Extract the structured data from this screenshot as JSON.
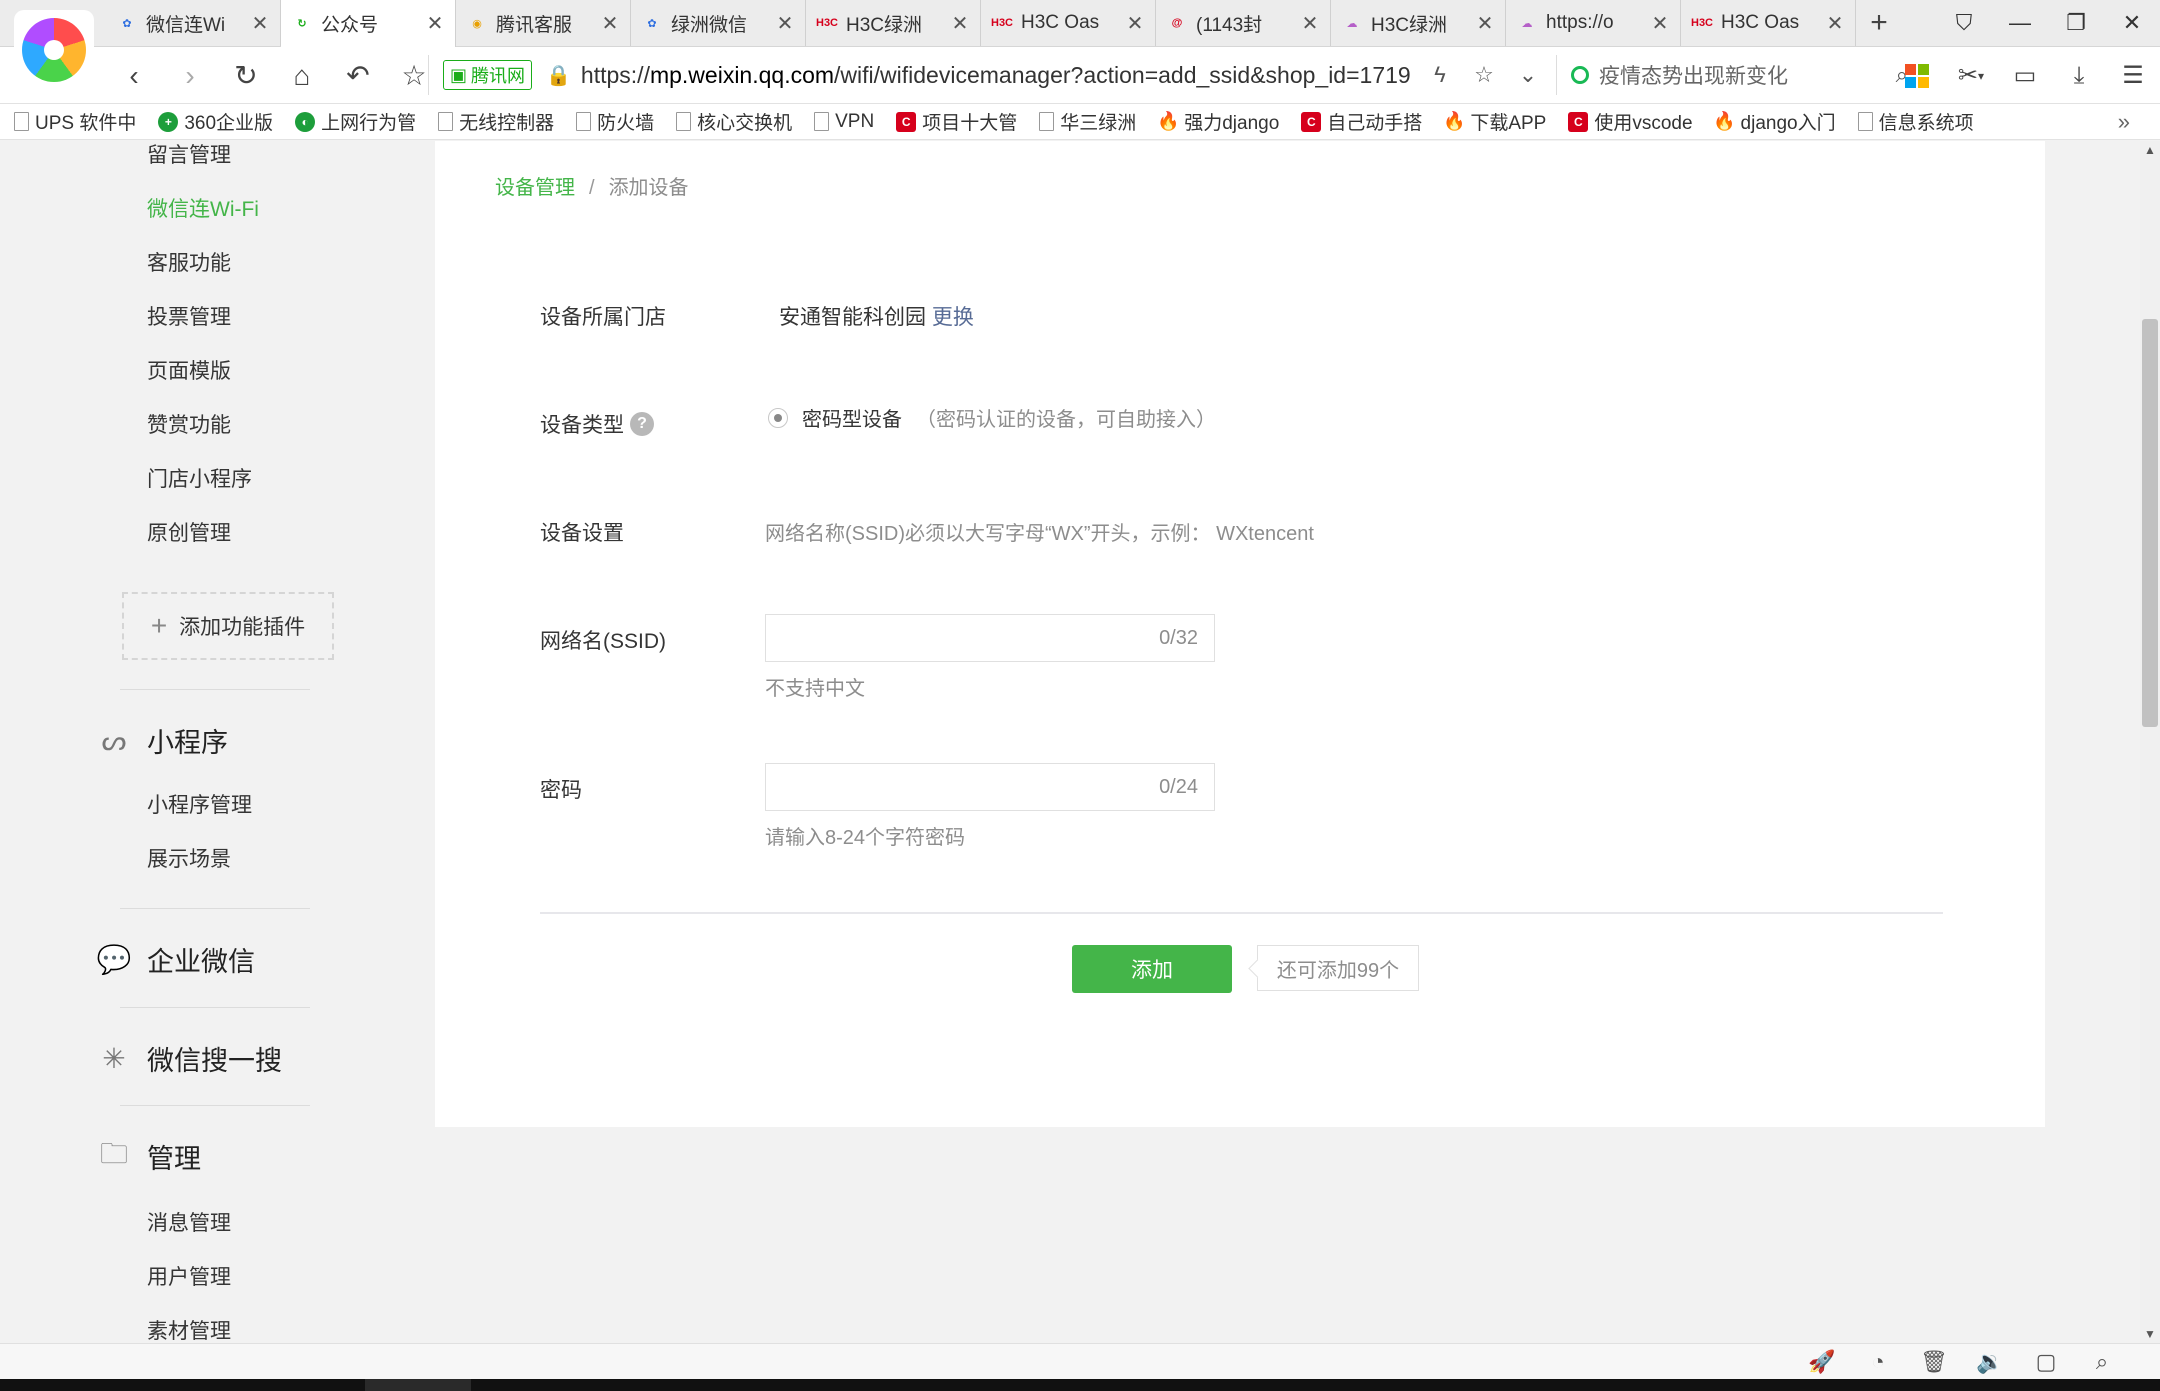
{
  "tabs": [
    {
      "title": "微信连Wi",
      "icon": "paw-icon",
      "color": "#2f6fe0",
      "glyph": "✿",
      "active": false
    },
    {
      "title": "公众号",
      "icon": "wechat-refresh-icon",
      "color": "#1aad19",
      "glyph": "↻",
      "active": true
    },
    {
      "title": "腾讯客服",
      "icon": "browser-icon",
      "color": "#e8a000",
      "glyph": "◉",
      "active": false
    },
    {
      "title": "绿洲微信",
      "icon": "paw-icon",
      "color": "#2f6fe0",
      "glyph": "✿",
      "active": false
    },
    {
      "title": "H3C绿洲",
      "icon": "h3c-icon",
      "color": "#d6001c",
      "glyph": "H3C",
      "active": false
    },
    {
      "title": "H3C Oas",
      "icon": "h3c-icon",
      "color": "#d6001c",
      "glyph": "H3C",
      "active": false
    },
    {
      "title": "(1143封",
      "icon": "mail-icon",
      "color": "#d6001c",
      "glyph": "@",
      "active": false
    },
    {
      "title": "H3C绿洲",
      "icon": "cloud-icon",
      "color": "#b55fc8",
      "glyph": "☁",
      "active": false
    },
    {
      "title": "https://o",
      "icon": "cloud-icon",
      "color": "#b55fc8",
      "glyph": "☁",
      "active": false
    },
    {
      "title": "H3C Oas",
      "icon": "h3c-icon",
      "color": "#d6001c",
      "glyph": "H3C",
      "active": false
    }
  ],
  "address": {
    "secure_label": "腾讯网",
    "url_prefix": "https://",
    "url_host": "mp.weixin.qq.com",
    "url_path": "/wifi/wifidevicemanager?action=add_ssid&shop_id=1719",
    "search_text": "疫情态势出现新变化"
  },
  "bookmarks": [
    {
      "label": "UPS 软件中",
      "type": "page"
    },
    {
      "label": "360企业版",
      "type": "green",
      "glyph": "+"
    },
    {
      "label": "上网行为管",
      "type": "green",
      "glyph": "◐"
    },
    {
      "label": "无线控制器",
      "type": "page"
    },
    {
      "label": "防火墙",
      "type": "page"
    },
    {
      "label": "核心交换机",
      "type": "page"
    },
    {
      "label": "VPN",
      "type": "page"
    },
    {
      "label": "项目十大管",
      "type": "red",
      "glyph": "C"
    },
    {
      "label": "华三绿洲",
      "type": "page"
    },
    {
      "label": "强力django",
      "type": "fire",
      "glyph": "🔥"
    },
    {
      "label": "自己动手搭",
      "type": "red",
      "glyph": "C"
    },
    {
      "label": "下载APP",
      "type": "fire",
      "glyph": "🔥"
    },
    {
      "label": "使用vscode",
      "type": "red",
      "glyph": "C"
    },
    {
      "label": "django入门",
      "type": "fire",
      "glyph": "🔥"
    },
    {
      "label": "信息系统项",
      "type": "page"
    }
  ],
  "sidebar": {
    "top_items": [
      {
        "label": "留言管理",
        "active": false
      },
      {
        "label": "微信连Wi-Fi",
        "active": true
      },
      {
        "label": "客服功能",
        "active": false
      },
      {
        "label": "投票管理",
        "active": false
      },
      {
        "label": "页面模版",
        "active": false
      },
      {
        "label": "赞赏功能",
        "active": false
      },
      {
        "label": "门店小程序",
        "active": false
      },
      {
        "label": "原创管理",
        "active": false
      }
    ],
    "add_plugin": "添加功能插件",
    "miniprogram": {
      "title": "小程序",
      "items": [
        "小程序管理",
        "展示场景"
      ]
    },
    "work_wechat": {
      "title": "企业微信"
    },
    "search": {
      "title": "微信搜一搜"
    },
    "manage": {
      "title": "管理",
      "items": [
        "消息管理",
        "用户管理",
        "素材管理"
      ]
    }
  },
  "breadcrumb": {
    "parent": "设备管理",
    "separator": "/",
    "current": "添加设备"
  },
  "form": {
    "store_label": "设备所属门店",
    "store_value": "安通智能科创园",
    "store_change": "更换",
    "type_label": "设备类型",
    "type_option": "密码型设备",
    "type_hint": "（密码认证的设备，可自助接入）",
    "setting_label": "设备设置",
    "setting_hint": "网络名称(SSID)必须以大写字母“WX”开头，示例：  WXtencent",
    "ssid_label": "网络名(SSID)",
    "ssid_value": "",
    "ssid_counter": "0/32",
    "ssid_hint": "不支持中文",
    "pwd_label": "密码",
    "pwd_value": "",
    "pwd_counter": "0/24",
    "pwd_hint": "请输入8-24个字符密码",
    "add_button": "添加",
    "remaining": "还可添加99个"
  }
}
